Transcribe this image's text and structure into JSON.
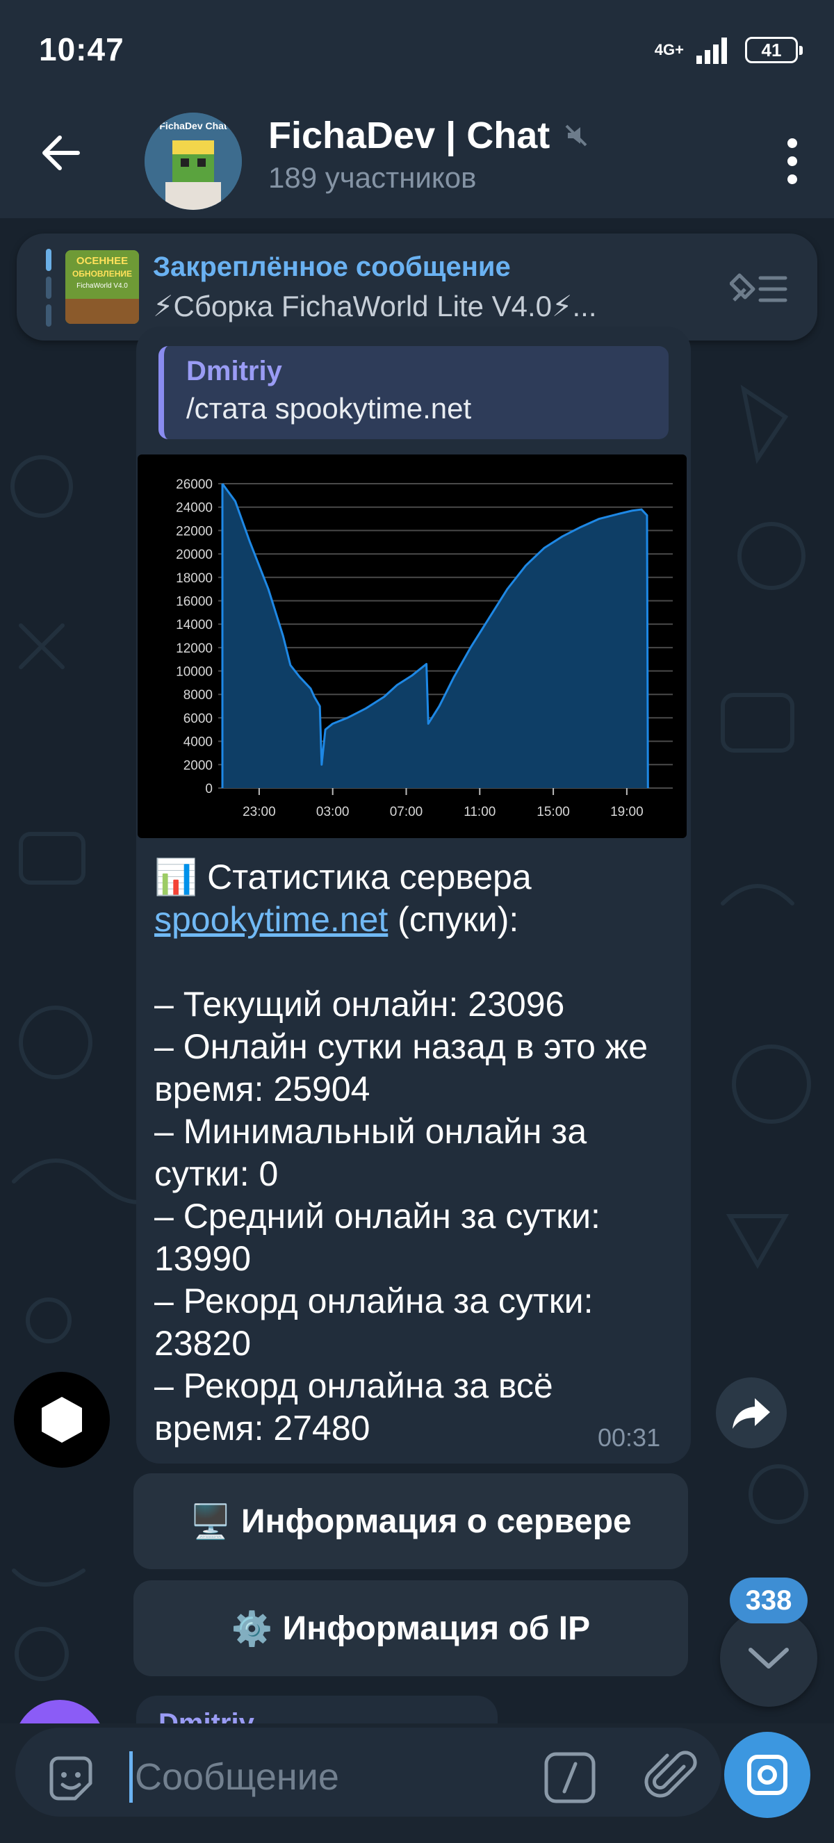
{
  "status_bar": {
    "time": "10:47",
    "network": "4G+",
    "battery": "41"
  },
  "header": {
    "title": "FichaDev | Chat",
    "subtitle": "189 участников",
    "avatar_caption": "FichaDev Chat"
  },
  "pinned": {
    "title": "Закреплённое сообщение",
    "text": "⚡Сборка FichaWorld Lite V4.0⚡...",
    "thumb_lines": [
      "ОСЕННЕЕ",
      "ОБНОВЛЕНИЕ",
      "FichaWorld V4.0"
    ]
  },
  "message": {
    "reply": {
      "name": "Dmitriy",
      "text": "/стата spookytime.net"
    },
    "intro": "📊 Статистика сервера",
    "link": "spookytime.net",
    "link_suffix": " (спуки):",
    "lines": [
      "– Текущий онлайн: 23096",
      "– Онлайн сутки назад в это же время: 25904",
      "– Минимальный онлайн за сутки: 0",
      "– Средний онлайн за сутки: 13990",
      "– Рекорд онлайна за сутки: 23820",
      "– Рекорд онлайна за всё время: 27480"
    ],
    "time": "00:31"
  },
  "buttons": [
    {
      "icon": "🖥️",
      "label": "Информация о сервере"
    },
    {
      "icon": "⚙️",
      "label": "Информация об IP"
    }
  ],
  "unread_badge": "338",
  "next_message_name": "Dmitriy",
  "input": {
    "placeholder": "Сообщение"
  },
  "colors": {
    "accent": "#6ab2f2",
    "bubble": "#212d3b",
    "chart_fill": "#0e3e66",
    "chart_line": "#1e88e5"
  },
  "chart_data": {
    "type": "area",
    "x_tick_labels": [
      "23:00",
      "03:00",
      "07:00",
      "11:00",
      "15:00",
      "19:00"
    ],
    "x_tick_positions": [
      2,
      6,
      10,
      14,
      18,
      22
    ],
    "x_range": [
      0,
      24.5
    ],
    "ylim": [
      0,
      26000
    ],
    "y_ticks": [
      0,
      2000,
      4000,
      6000,
      8000,
      10000,
      12000,
      14000,
      16000,
      18000,
      20000,
      22000,
      24000,
      26000
    ],
    "grid": true,
    "points": [
      [
        0,
        26000
      ],
      [
        0.7,
        24500
      ],
      [
        1.5,
        21000
      ],
      [
        2.5,
        17000
      ],
      [
        3.3,
        13000
      ],
      [
        3.7,
        10500
      ],
      [
        4.2,
        9500
      ],
      [
        4.8,
        8500
      ],
      [
        5.0,
        7800
      ],
      [
        5.3,
        7000
      ],
      [
        5.4,
        2000
      ],
      [
        5.6,
        5000
      ],
      [
        6.0,
        5500
      ],
      [
        6.8,
        6000
      ],
      [
        7.8,
        6800
      ],
      [
        8.8,
        7800
      ],
      [
        9.5,
        8800
      ],
      [
        10.3,
        9600
      ],
      [
        11.1,
        10600
      ],
      [
        11.2,
        5500
      ],
      [
        11.8,
        7000
      ],
      [
        12.6,
        9500
      ],
      [
        13.5,
        12000
      ],
      [
        14.5,
        14500
      ],
      [
        15.5,
        17000
      ],
      [
        16.5,
        19000
      ],
      [
        17.5,
        20500
      ],
      [
        18.5,
        21500
      ],
      [
        19.5,
        22300
      ],
      [
        20.5,
        23000
      ],
      [
        21.5,
        23400
      ],
      [
        22.3,
        23700
      ],
      [
        22.8,
        23800
      ],
      [
        23.1,
        23300
      ],
      [
        23.15,
        0
      ]
    ]
  }
}
